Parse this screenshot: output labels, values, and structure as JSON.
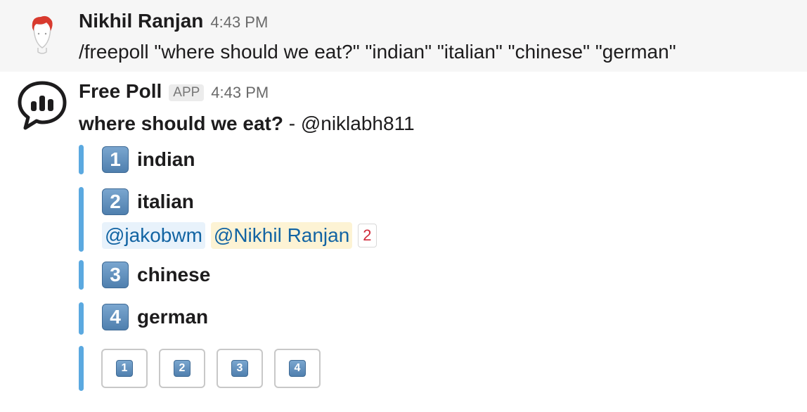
{
  "messages": {
    "user": {
      "sender": "Nikhil Ranjan",
      "time": "4:43 PM",
      "text": "/freepoll \"where should we eat?\" \"indian\" \"italian\" \"chinese\" \"german\""
    },
    "bot": {
      "sender": "Free Poll",
      "badge": "APP",
      "time": "4:43 PM",
      "question": "where should we eat?",
      "separator": " - ",
      "author_mention": "@niklabh811"
    }
  },
  "poll": {
    "options": [
      {
        "key": "1",
        "label": "indian"
      },
      {
        "key": "2",
        "label": "italian"
      },
      {
        "key": "3",
        "label": "chinese"
      },
      {
        "key": "4",
        "label": "german"
      }
    ],
    "option_2_voters": [
      "@jakobwm",
      "@Nikhil Ranjan"
    ],
    "option_2_count": "2",
    "vote_buttons": [
      "1",
      "2",
      "3",
      "4"
    ]
  },
  "colors": {
    "attachment_bar": "#5ba9e0",
    "mention_text": "#1264a3",
    "count_text": "#d02b3b"
  },
  "icons": {
    "user_avatar": "red-haired-person-avatar-icon",
    "bot_avatar": "speech-bubble-bar-chart-icon"
  }
}
